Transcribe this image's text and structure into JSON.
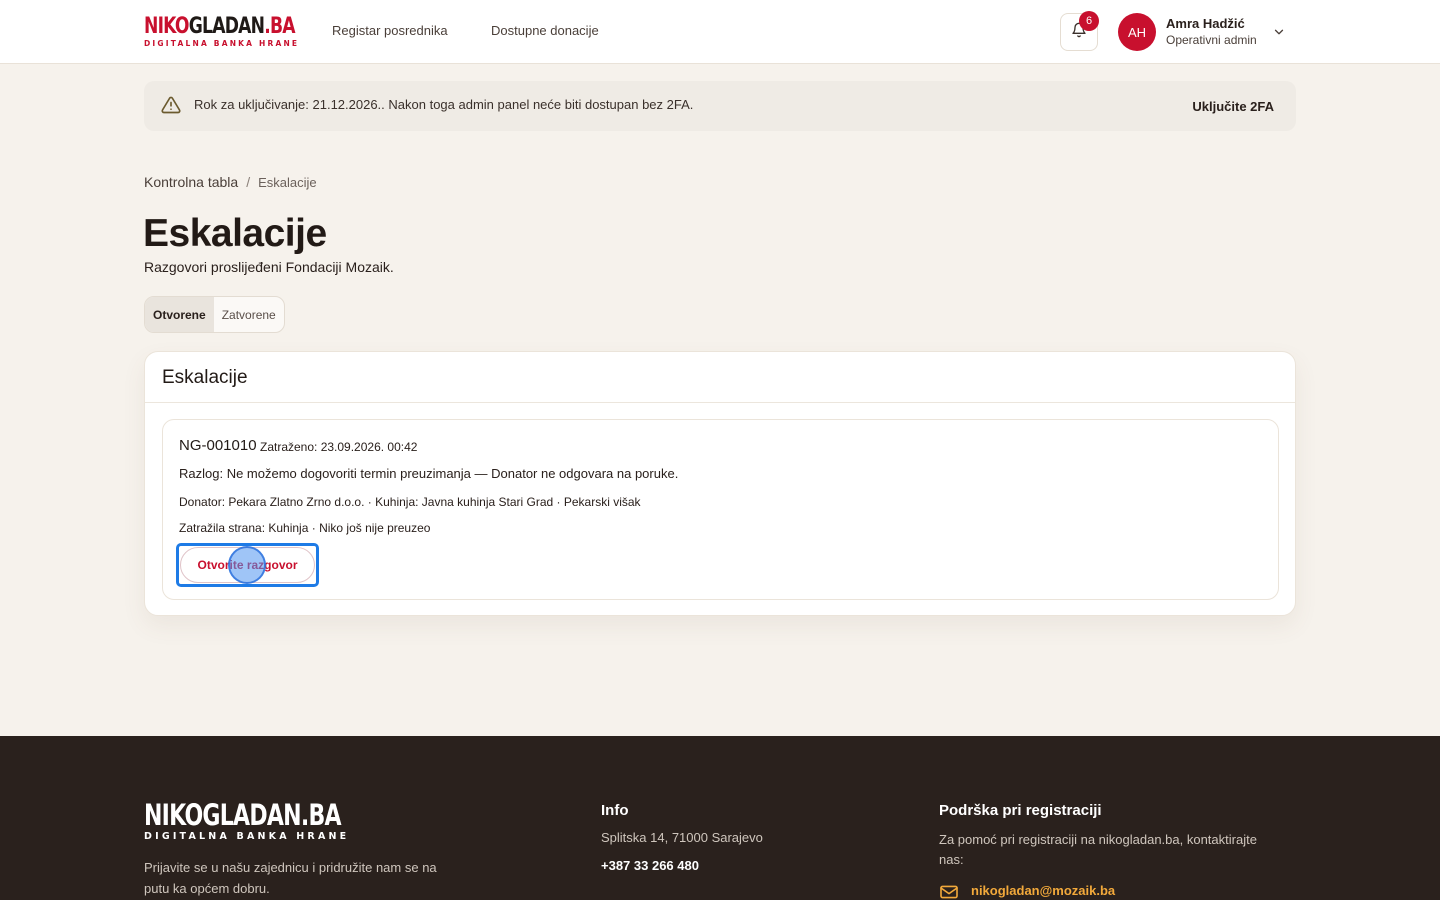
{
  "header": {
    "logo_main_a": "NIKO",
    "logo_main_b": "GLADAN",
    "logo_main_c": ".BA",
    "logo_sub": "DIGITALNA BANKA HRANE",
    "nav": [
      {
        "label": "Registar posrednika"
      },
      {
        "label": "Dostupne donacije"
      }
    ],
    "notifications_count": "6",
    "user": {
      "initials": "AH",
      "name": "Amra Hadžić",
      "role": "Operativni admin"
    }
  },
  "alert": {
    "text": "Rok za uključivanje: 21.12.2026.. Nakon toga admin panel neće biti dostupan bez 2FA.",
    "action": "Uključite 2FA"
  },
  "breadcrumb": {
    "parent": "Kontrolna tabla",
    "separator": "/",
    "current": "Eskalacije"
  },
  "page": {
    "title": "Eskalacije",
    "subtitle": "Razgovori proslijeđeni Fondaciji Mozaik."
  },
  "tabs": [
    {
      "label": "Otvorene",
      "active": true
    },
    {
      "label": "Zatvorene",
      "active": false
    }
  ],
  "card": {
    "title": "Eskalacije",
    "items": [
      {
        "id": "NG-001010",
        "requested": "Zatraženo: 23.09.2026. 00:42",
        "reason": "Razlog: Ne možemo dogovoriti termin preuzimanja — Donator ne odgovara na poruke.",
        "donor_line": "Donator: Pekara Zlatno Zrno d.o.o. · Kuhinja: Javna kuhinja Stari Grad · Pekarski višak",
        "requester_line": "Zatražila strana: Kuhinja · Niko još nije preuzeo",
        "button": "Otvorite razgovor"
      }
    ]
  },
  "footer": {
    "logo_main": "NIKOGLADAN.BA",
    "logo_sub": "DIGITALNA BANKA HRANE",
    "description": "Prijavite se u našu zajednicu i pridružite nam se na putu ka općem dobru.",
    "info_heading": "Info",
    "address": "Splitska 14, 71000 Sarajevo",
    "phone": "+387 33 266 480",
    "support_heading": "Podrška pri registraciji",
    "support_text": "Za pomoć pri registraciji na nikogladan.ba, kontaktirajte nas:",
    "email": "nikogladan@mozaik.ba"
  },
  "colors": {
    "brand_red": "#c8102e",
    "footer_bg": "#2a211d",
    "page_bg": "#f6f2ec",
    "focus_blue": "#1e7be6",
    "email_accent": "#f2a93b"
  }
}
